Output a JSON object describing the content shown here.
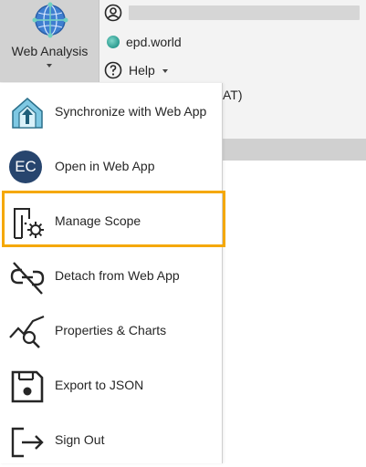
{
  "ribbon": {
    "web_analysis_label": "Web Analysis",
    "epd_label": "epd.world",
    "help_label": "Help",
    "partial_text": "AT)"
  },
  "menu": {
    "items": [
      {
        "label": "Synchronize with Web App",
        "icon": "sync-upload-icon"
      },
      {
        "label": "Open in Web App",
        "icon": "ec-logo-icon",
        "icon_text": "EC"
      },
      {
        "label": "Manage Scope",
        "icon": "manage-scope-icon"
      },
      {
        "label": "Detach from Web App",
        "icon": "unlink-icon"
      },
      {
        "label": "Properties & Charts",
        "icon": "chart-search-icon"
      },
      {
        "label": "Export to JSON",
        "icon": "save-icon"
      },
      {
        "label": "Sign Out",
        "icon": "sign-out-icon"
      }
    ],
    "highlighted_item": "Manage Scope"
  },
  "colors": {
    "highlight": "#f5a800",
    "ec_logo": "#27456e",
    "ribbon_bg": "#f3f3f3",
    "button_active": "#d2d2d2"
  }
}
